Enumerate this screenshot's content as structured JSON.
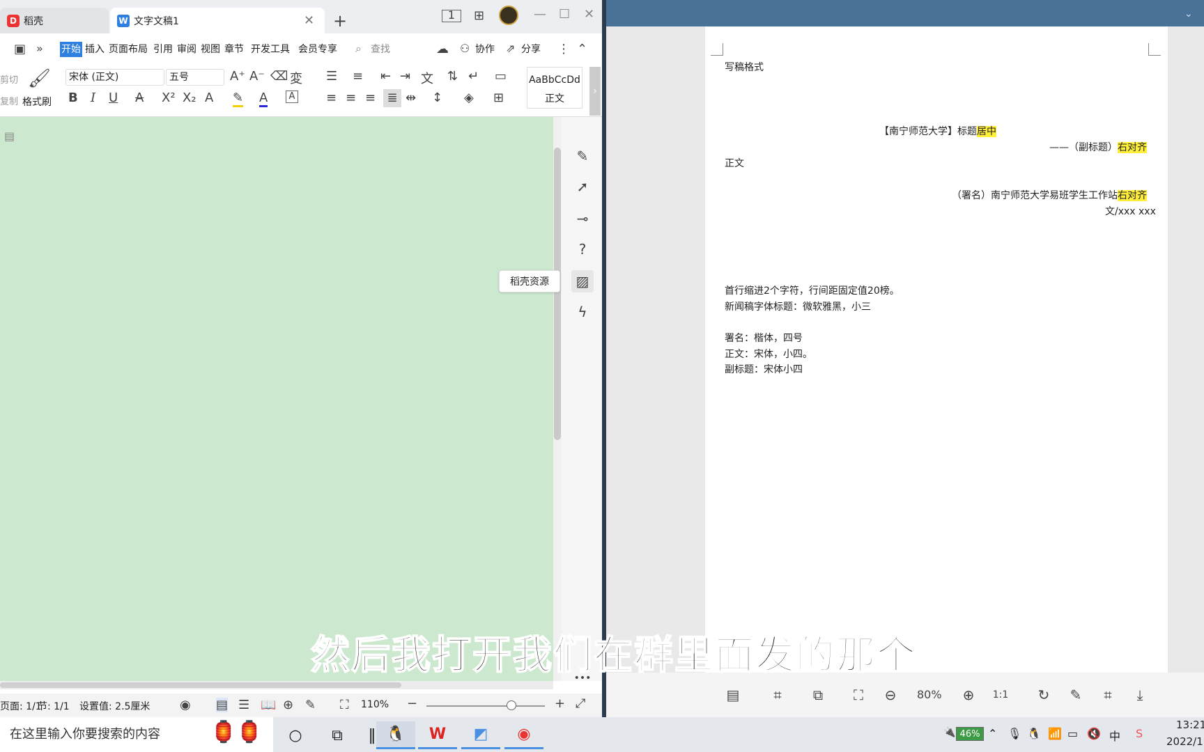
{
  "wps": {
    "tabs": [
      {
        "label": "稻壳"
      },
      {
        "label": "文字文稿1"
      }
    ],
    "menu": [
      "开始",
      "插入",
      "页面布局",
      "引用",
      "审阅",
      "视图",
      "章节",
      "开发工具",
      "会员专享"
    ],
    "search_placeholder": "查找",
    "collab": "协作",
    "share": "分享",
    "ribbon": {
      "cut": "剪切",
      "copy": "复制",
      "format_painter": "格式刷",
      "font": "宋体 (正文)",
      "size": "五号",
      "style_preview": "AaBbCcDd",
      "style_name": "正文"
    },
    "tooltip": "稻壳资源",
    "status": {
      "page": "页面: 1/1",
      "section": "节: 1/1",
      "setting": "设置值: 2.5厘米",
      "zoom": "110%",
      "zoom_level": 0.72
    }
  },
  "viewer": {
    "lines": [
      {
        "text": "写稿格式"
      },
      {
        "text": "【南宁师范大学】标题",
        "hl": "居中"
      },
      {
        "text": "——（副标题）",
        "hl": "右对齐"
      },
      {
        "text": "正文"
      },
      {
        "text": "（署名）南宁师范大学易班学生工作站",
        "hl": "右对齐"
      },
      {
        "text": "文/xxx  xxx"
      },
      {
        "text": "首行缩进2个字符，行间距固定值20榜。"
      },
      {
        "text": "新闻稿字体标题：微软雅黑，小三"
      },
      {
        "text": "署名：楷体，四号"
      },
      {
        "text": "正文：宋体，小四。"
      },
      {
        "text": "副标题：宋体小四"
      }
    ],
    "zoom": "80%"
  },
  "taskbar": {
    "search": "在这里输入你要搜索的内容",
    "battery": "46%",
    "ime": "中",
    "time": "13:21",
    "date": "2022/1"
  },
  "subtitle": "然后我打开我们在群里面发的那个",
  "colors": {
    "accent": "#2f7fe0",
    "doc_bg": "#cce8cf",
    "highlight": "#ffef3a",
    "viewer_top": "#4a7196"
  }
}
